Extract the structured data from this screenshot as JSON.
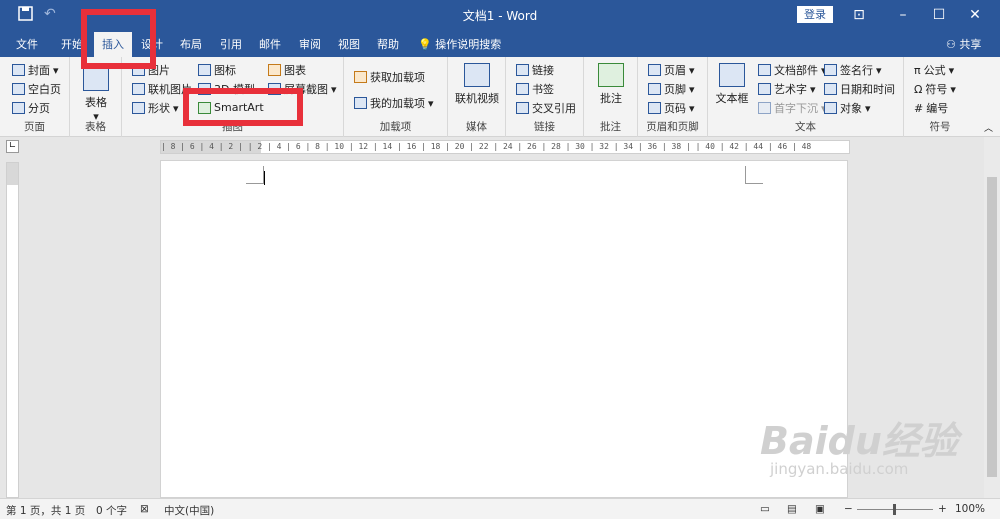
{
  "window": {
    "title": "文档1  -  Word",
    "login_label": "登录"
  },
  "tabs": [
    "文件",
    "开始",
    "插入",
    "设计",
    "布局",
    "引用",
    "邮件",
    "审阅",
    "视图",
    "帮助"
  ],
  "tellme": "操作说明搜索",
  "share": "共享",
  "ribbon": {
    "pages": {
      "label": "页面",
      "items": [
        "封面",
        "空白页",
        "分页"
      ]
    },
    "table": {
      "label": "表格",
      "button": "表格"
    },
    "illustrations": {
      "label": "插图",
      "items": [
        "图片",
        "联机图片",
        "形状",
        "图标",
        "3D 模型",
        "SmartArt",
        "图表",
        "屏幕截图"
      ]
    },
    "addins": {
      "label": "加载项",
      "items": [
        "获取加载项",
        "我的加载项"
      ]
    },
    "media": {
      "label": "媒体",
      "button": "联机视频"
    },
    "links": {
      "label": "链接",
      "items": [
        "链接",
        "书签",
        "交叉引用"
      ]
    },
    "comments": {
      "label": "批注",
      "button": "批注"
    },
    "headerfooter": {
      "label": "页眉和页脚",
      "items": [
        "页眉",
        "页脚",
        "页码"
      ]
    },
    "text": {
      "label": "文本",
      "textbox": "文本框",
      "items": [
        "文档部件",
        "艺术字",
        "首字下沉",
        "签名行",
        "日期和时间",
        "对象"
      ]
    },
    "symbols": {
      "label": "符号",
      "items": [
        "公式",
        "符号",
        "编号"
      ]
    }
  },
  "ruler": {
    "text": "| 8 |  6 |  4 |  2 |     | 2 |  4 |  6 |  8 | 10 | 12 | 14 | 16 | 18 | 20 | 22 | 24 | 26 | 28 | 30 | 32 | 34 | 36 | 38 |  | 40 | 42 | 44 | 46 | 48"
  },
  "status": {
    "page": "第 1 页，共 1 页",
    "words": "0 个字",
    "language": "中文(中国)",
    "zoom": "100%"
  },
  "watermark": {
    "brand": "Baidu经验",
    "url": "jingyan.baidu.com"
  }
}
